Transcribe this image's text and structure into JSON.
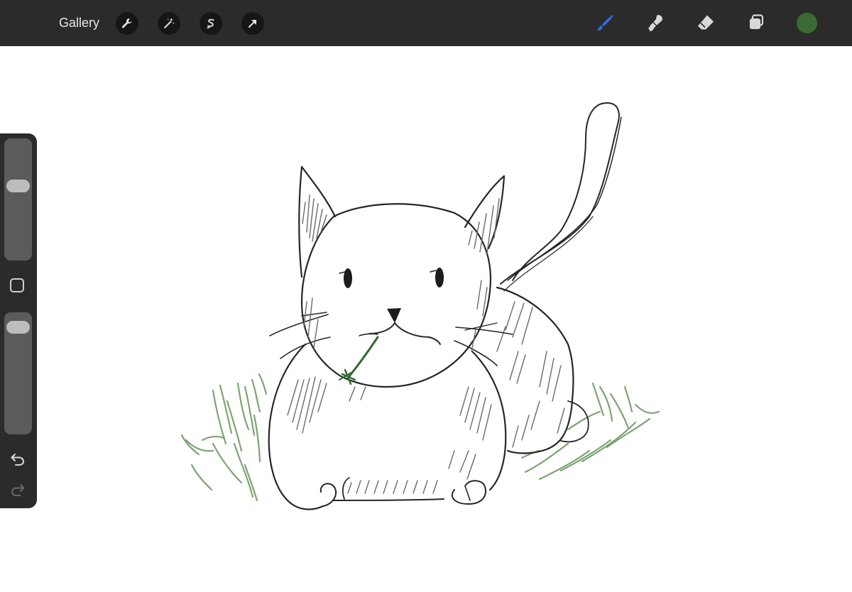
{
  "topbar": {
    "gallery_label": "Gallery",
    "left_tools": [
      {
        "name": "actions",
        "icon": "wrench-icon"
      },
      {
        "name": "adjustments",
        "icon": "magic-wand-icon"
      },
      {
        "name": "selection",
        "icon": "selection-s-icon"
      },
      {
        "name": "transform",
        "icon": "arrow-cursor-icon"
      }
    ],
    "right_tools": [
      {
        "name": "brush",
        "icon": "brush-icon",
        "active": true
      },
      {
        "name": "smudge",
        "icon": "smudge-icon"
      },
      {
        "name": "eraser",
        "icon": "eraser-icon"
      },
      {
        "name": "layers",
        "icon": "layers-icon"
      }
    ],
    "current_color": "#3a6a35",
    "active_tool_color": "#2f6fe0"
  },
  "sidebar": {
    "brush_size_level": 0.37,
    "opacity_level": 0.06,
    "modify_icon": "square-icon",
    "undo_icon": "undo-icon",
    "redo_icon": "redo-icon"
  },
  "canvas": {
    "background": "#ffffff",
    "ink_color": "#262626",
    "grass_color": "#6f9a63",
    "subject": "cat-sketch"
  }
}
